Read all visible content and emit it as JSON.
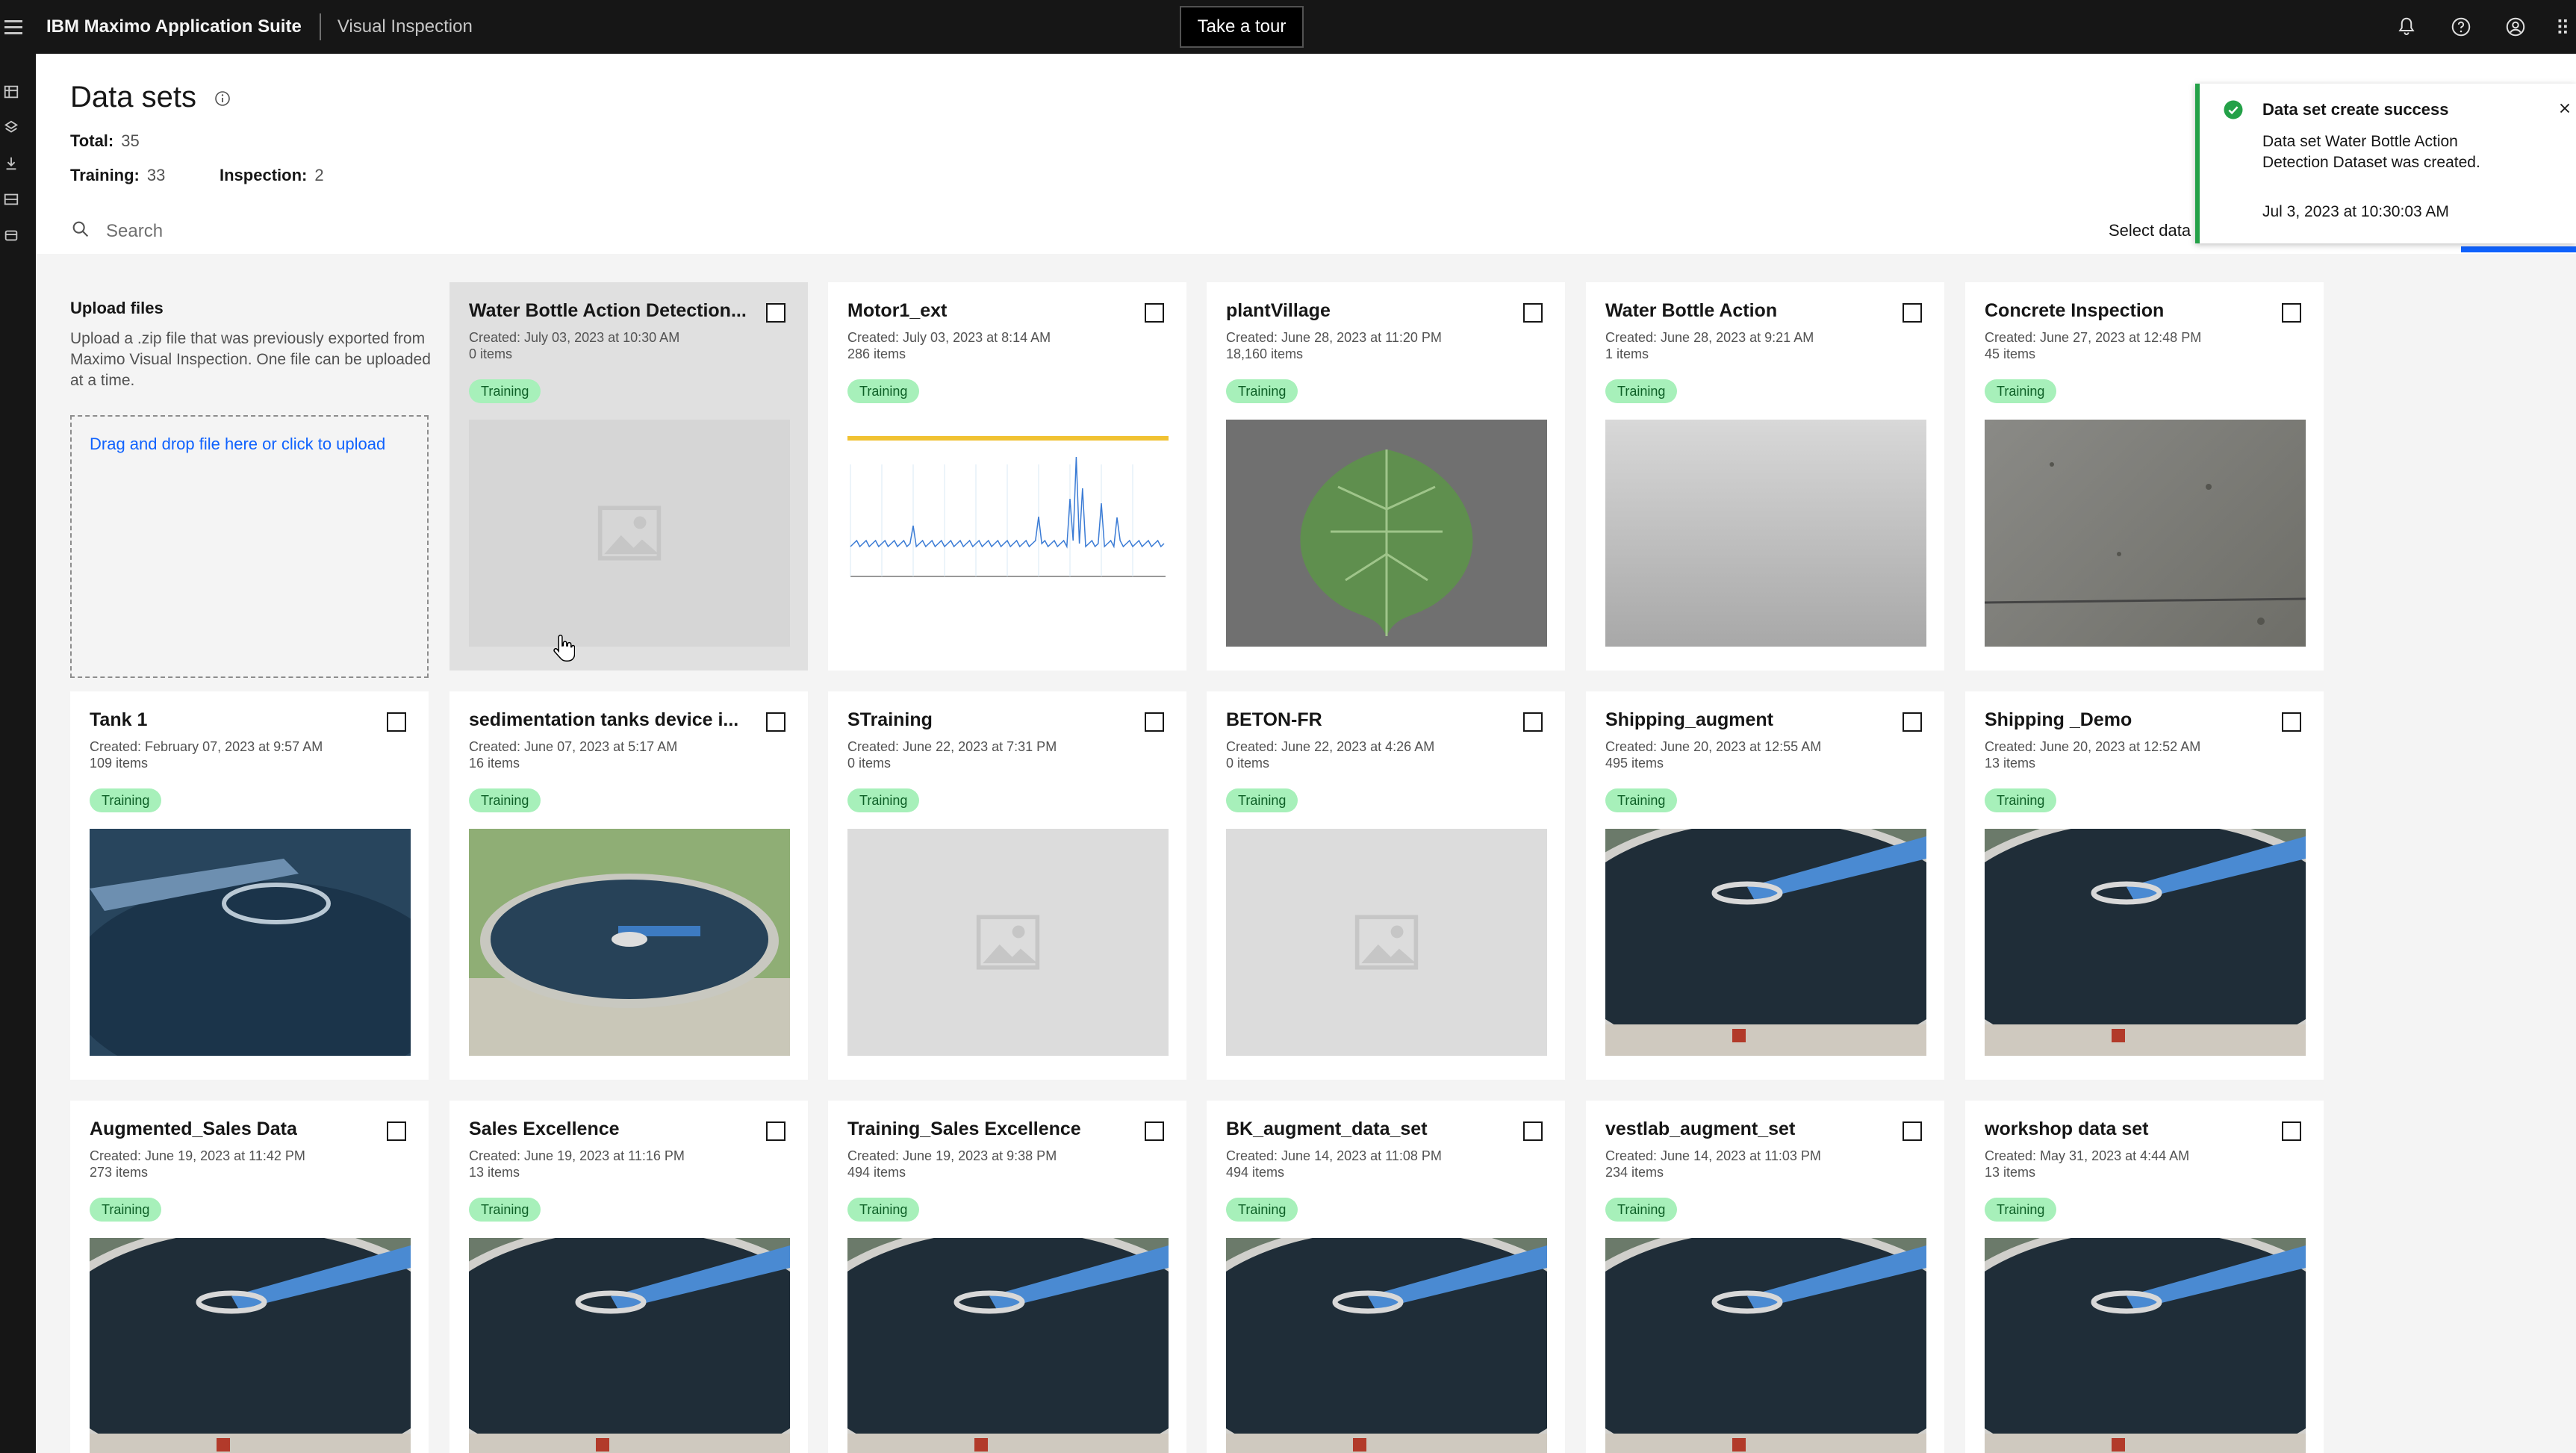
{
  "header": {
    "brand_bold": "IBM Maximo Application Suite",
    "product": "Visual Inspection",
    "tour_label": "Take a tour"
  },
  "page": {
    "title": "Data sets",
    "total_label": "Total:",
    "total_value": "35",
    "training_label": "Training:",
    "training_value": "33",
    "inspection_label": "Inspection:",
    "inspection_value": "2",
    "search_placeholder": "Search",
    "select_label": "Select data"
  },
  "upload": {
    "title": "Upload files",
    "description": "Upload a .zip file that was previously exported from Maximo Visual Inspection. One file can be uploaded at a time.",
    "drop_label": "Drag and drop file here or click to upload"
  },
  "toast": {
    "title": "Data set create success",
    "subtitle": "Data set Water Bottle Action Detection Dataset was created.",
    "time": "Jul 3, 2023 at 10:30:03 AM"
  },
  "cards": [
    {
      "name": "Water Bottle Action Detection...",
      "created": "Created: July 03, 2023 at 10:30 AM",
      "items": "0 items",
      "tag": "Training",
      "thumb": "placeholder"
    },
    {
      "name": "Motor1_ext",
      "created": "Created: July 03, 2023 at 8:14 AM",
      "items": "286 items",
      "tag": "Training",
      "thumb": "chart"
    },
    {
      "name": "plantVillage",
      "created": "Created: June 28, 2023 at 11:20 PM",
      "items": "18,160 items",
      "tag": "Training",
      "thumb": "leaf"
    },
    {
      "name": "Water Bottle Action",
      "created": "Created: June 28, 2023 at 9:21 AM",
      "items": "1 items",
      "tag": "Training",
      "thumb": "blur"
    },
    {
      "name": "Concrete Inspection",
      "created": "Created: June 27, 2023 at 12:48 PM",
      "items": "45 items",
      "tag": "Training",
      "thumb": "concrete"
    },
    {
      "name": "Tank 1",
      "created": "Created: February 07, 2023 at 9:57 AM",
      "items": "109 items",
      "tag": "Training",
      "thumb": "tank-top"
    },
    {
      "name": "sedimentation tanks device i...",
      "created": "Created: June 07, 2023 at 5:17 AM",
      "items": "16 items",
      "tag": "Training",
      "thumb": "tank-aerial"
    },
    {
      "name": "STraining",
      "created": "Created: June 22, 2023 at 7:31 PM",
      "items": "0 items",
      "tag": "Training",
      "thumb": "placeholder"
    },
    {
      "name": "BETON-FR",
      "created": "Created: June 22, 2023 at 4:26 AM",
      "items": "0 items",
      "tag": "Training",
      "thumb": "placeholder"
    },
    {
      "name": "Shipping_augment",
      "created": "Created: June 20, 2023 at 12:55 AM",
      "items": "495 items",
      "tag": "Training",
      "thumb": "tank"
    },
    {
      "name": "Shipping _Demo",
      "created": "Created: June 20, 2023 at 12:52 AM",
      "items": "13 items",
      "tag": "Training",
      "thumb": "tank"
    },
    {
      "name": "Augmented_Sales Data",
      "created": "Created: June 19, 2023 at 11:42 PM",
      "items": "273 items",
      "tag": "Training",
      "thumb": "tank"
    },
    {
      "name": "Sales Excellence",
      "created": "Created: June 19, 2023 at 11:16 PM",
      "items": "13 items",
      "tag": "Training",
      "thumb": "tank"
    },
    {
      "name": "Training_Sales Excellence",
      "created": "Created: June 19, 2023 at 9:38 PM",
      "items": "494 items",
      "tag": "Training",
      "thumb": "tank"
    },
    {
      "name": "BK_augment_data_set",
      "created": "Created: June 14, 2023 at 11:08 PM",
      "items": "494 items",
      "tag": "Training",
      "thumb": "tank"
    },
    {
      "name": "vestlab_augment_set",
      "created": "Created: June 14, 2023 at 11:03 PM",
      "items": "234 items",
      "tag": "Training",
      "thumb": "tank"
    },
    {
      "name": "workshop data set",
      "created": "Created: May 31, 2023 at 4:44 AM",
      "items": "13 items",
      "tag": "Training",
      "thumb": "tank"
    }
  ],
  "icons": {
    "menu": "menu-icon",
    "notification": "bell-icon",
    "help": "help-icon",
    "user": "user-icon",
    "switcher": "app-switcher-icon",
    "success": "checkmark-filled-icon",
    "close": "close-icon",
    "search": "search-icon",
    "info": "info-icon",
    "image": "image-placeholder-icon"
  },
  "colors": {
    "topbar": "#161616",
    "tag_bg": "#a7f0ba",
    "tag_text": "#0e6027",
    "link": "#0f62fe",
    "success": "#24a148"
  }
}
